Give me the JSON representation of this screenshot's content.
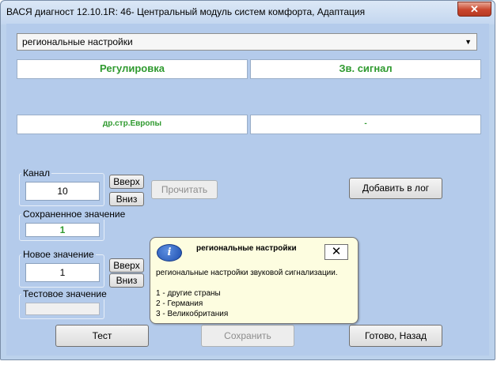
{
  "window": {
    "title": "ВАСЯ диагност 12.10.1R: 46- Центральный модуль систем комфорта, Адаптация",
    "close_label": "✕"
  },
  "dropdown": {
    "value": "региональные настройки"
  },
  "table": {
    "header_left": "Регулировка",
    "header_right": "Зв. сигнал",
    "value_left": "др.стр.Европы",
    "value_right": "-"
  },
  "channel": {
    "label": "Канал",
    "value": "10",
    "up_label": "Вверх",
    "down_label": "Вниз"
  },
  "read_button": "Прочитать",
  "add_log_button": "Добавить в лог",
  "saved": {
    "label": "Сохраненное значение",
    "value": "1"
  },
  "new_value": {
    "label": "Новое значение",
    "value": "1",
    "up_label": "Вверх",
    "down_label": "Вниз"
  },
  "test_value": {
    "label": "Тестовое значение",
    "value": ""
  },
  "buttons": {
    "test": "Тест",
    "save": "Сохранить",
    "done": "Готово, Назад"
  },
  "tooltip": {
    "icon": "info-icon",
    "title": "региональные настройки",
    "close_label": "✕",
    "description": "региональные настройки звуковой сигнализации.",
    "options": [
      "1 - другие страны",
      "2 - Германия",
      "3 - Великобритания"
    ]
  },
  "colors": {
    "accent_green": "#2f9a2f",
    "background": "#b4cbeb",
    "tooltip_bg": "#fdfde0"
  }
}
